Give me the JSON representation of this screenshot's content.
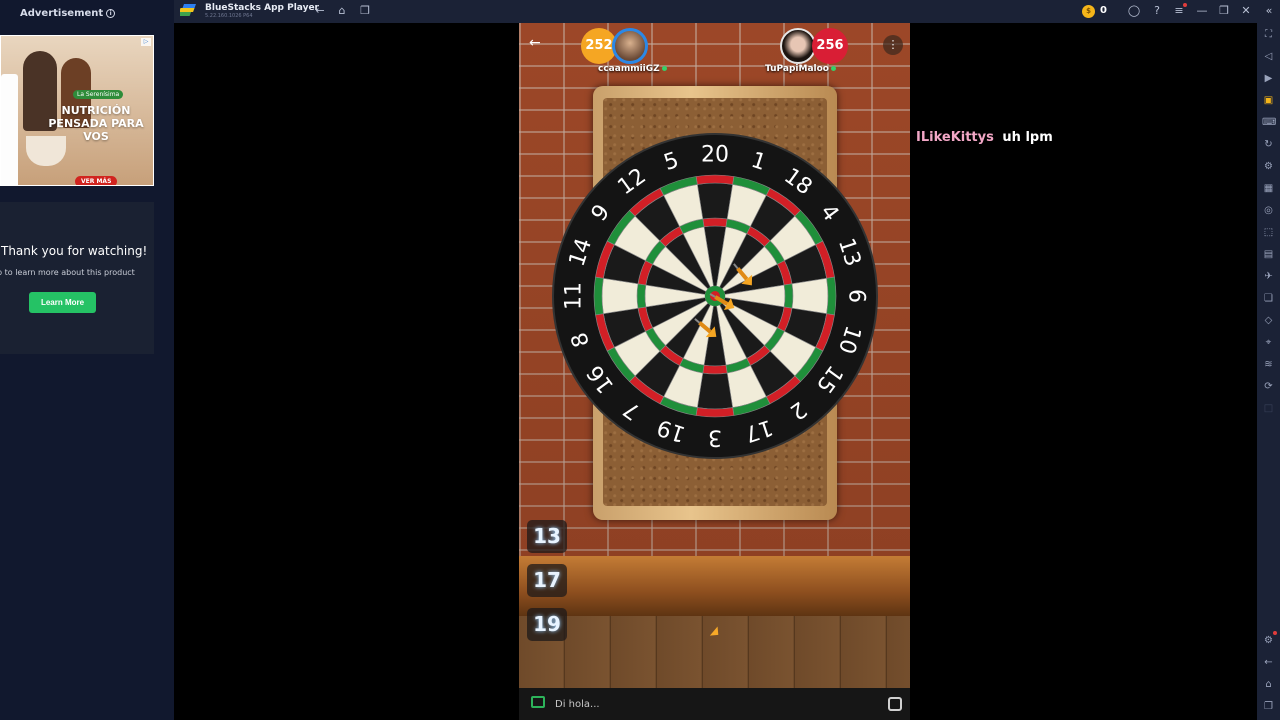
{
  "ad": {
    "header": "Advertisement",
    "banner_brand": "La Serenísima",
    "banner_headline": "NUTRICIÓN PENSADA PARA VOS",
    "banner_cta": "VER MÁS",
    "thanks_title": "Thank you for watching!",
    "thanks_subtitle": "p to learn more about this product",
    "learn_more": "Learn More"
  },
  "window": {
    "title": "BlueStacks App Player",
    "version": "5.22.160.1026  P64",
    "coins": "0"
  },
  "game": {
    "player_left": {
      "name": "ccaammiiGZ",
      "score": "252"
    },
    "player_right": {
      "name": "TuPapiMaloo",
      "score": "256"
    },
    "throw_scores": [
      "13",
      "17",
      "19"
    ],
    "board_numbers": [
      "20",
      "1",
      "18",
      "4",
      "13",
      "6",
      "10",
      "15",
      "2",
      "17",
      "3",
      "19",
      "7",
      "16",
      "8",
      "11",
      "14",
      "9",
      "12",
      "5"
    ],
    "chat_placeholder": "Di hola..."
  },
  "overlay_chat": {
    "user": "ILikeKittys",
    "message": "uh lpm"
  },
  "colors": {
    "accent_green": "#25c265",
    "score_left": "#f5a623",
    "score_right": "#d91e35",
    "board_red": "#d21f26",
    "board_green": "#1f8f3a"
  }
}
